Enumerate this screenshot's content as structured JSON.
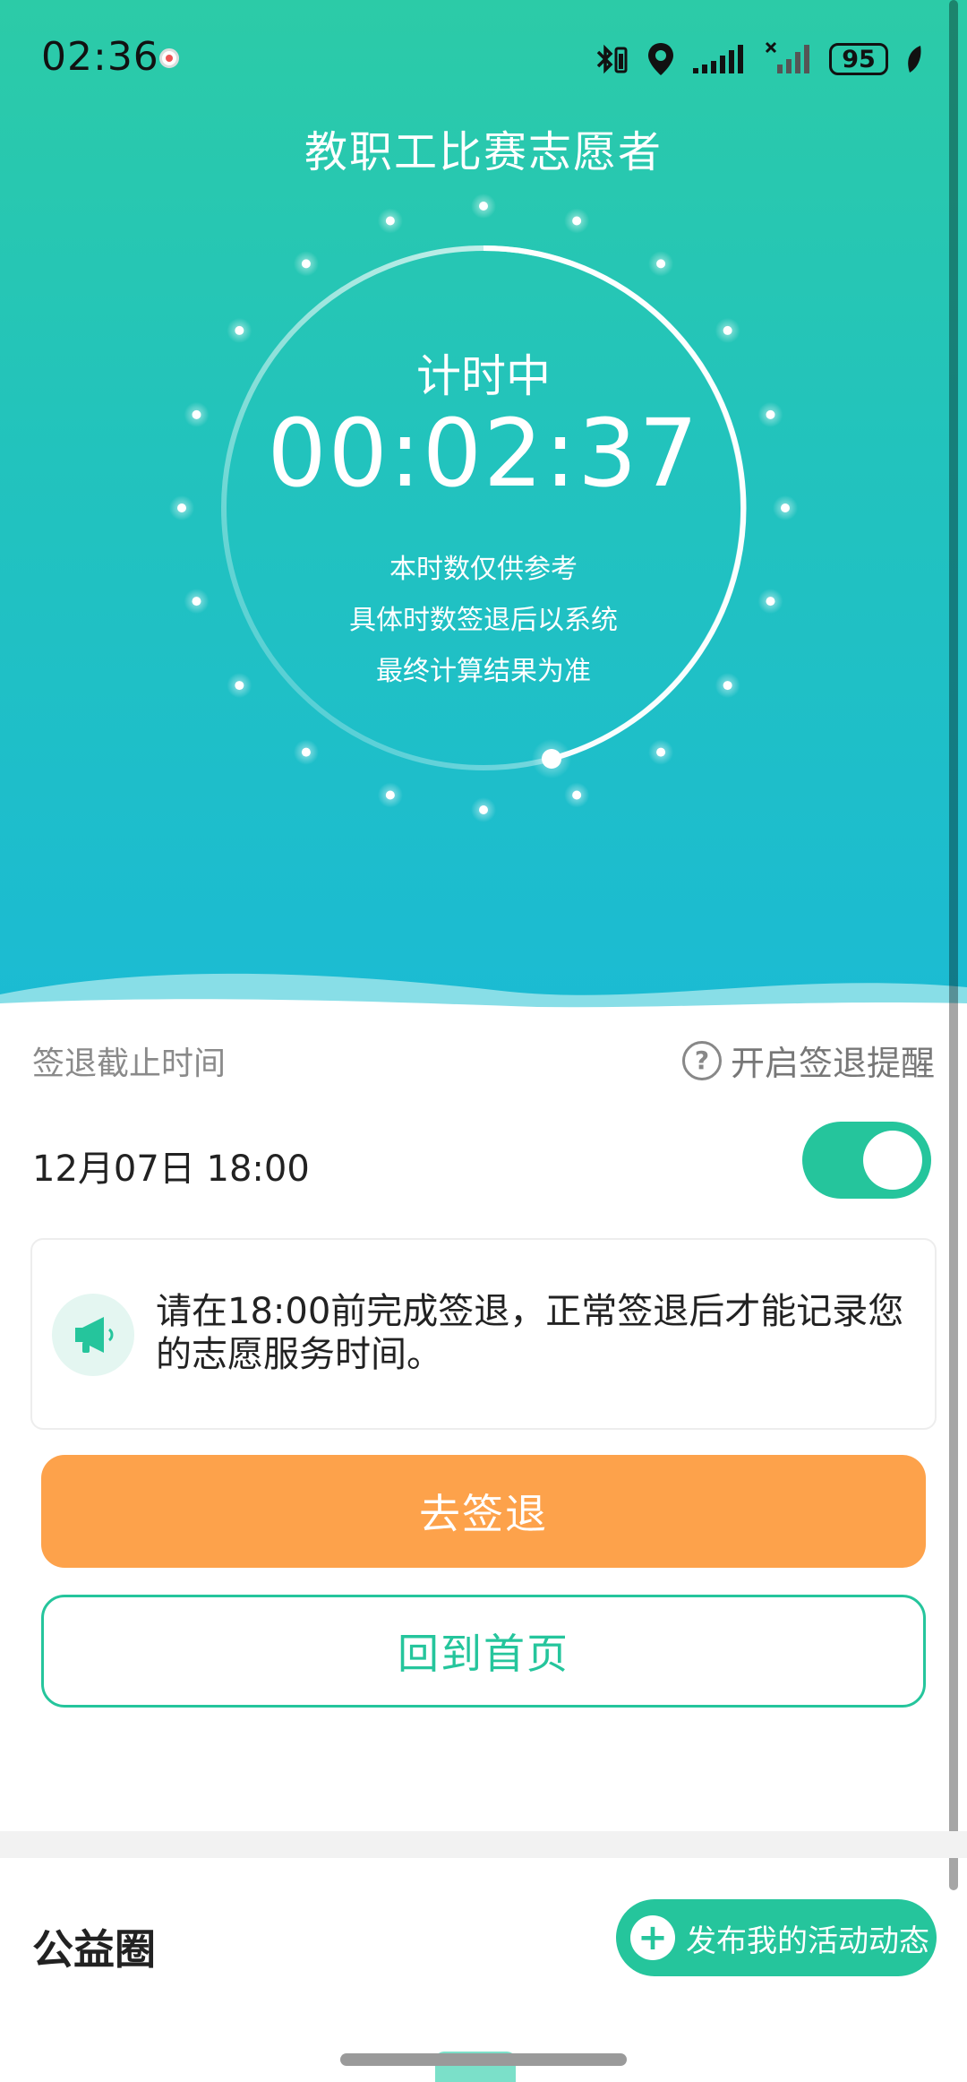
{
  "status_bar": {
    "time": "02:36",
    "battery": "95",
    "icons": [
      "recording-icon",
      "bluetooth-icon",
      "location-icon",
      "signal-icon",
      "no-signal-icon",
      "battery-icon",
      "leaf-icon"
    ]
  },
  "header": {
    "title": "教职工比赛志愿者"
  },
  "timer": {
    "label": "计时中",
    "value": "00:02:37",
    "notes": [
      "本时数仅供参考",
      "具体时数签退后以系统",
      "最终计算结果为准"
    ]
  },
  "checkout": {
    "deadline_label": "签退截止时间",
    "reminder_label": "开启签退提醒",
    "deadline_value": "12月07日 18:00",
    "reminder_on": true
  },
  "notice": {
    "text": "请在18:00前完成签退，正常签退后才能记录您的志愿服务时间。"
  },
  "buttons": {
    "checkout": "去签退",
    "home": "回到首页"
  },
  "community": {
    "title": "公益圈",
    "publish": "发布我的活动动态"
  },
  "colors": {
    "accent": "#25c59c",
    "hero_top": "#2ccba7",
    "hero_bottom": "#1bbbd3",
    "orange": "#fda24b"
  }
}
